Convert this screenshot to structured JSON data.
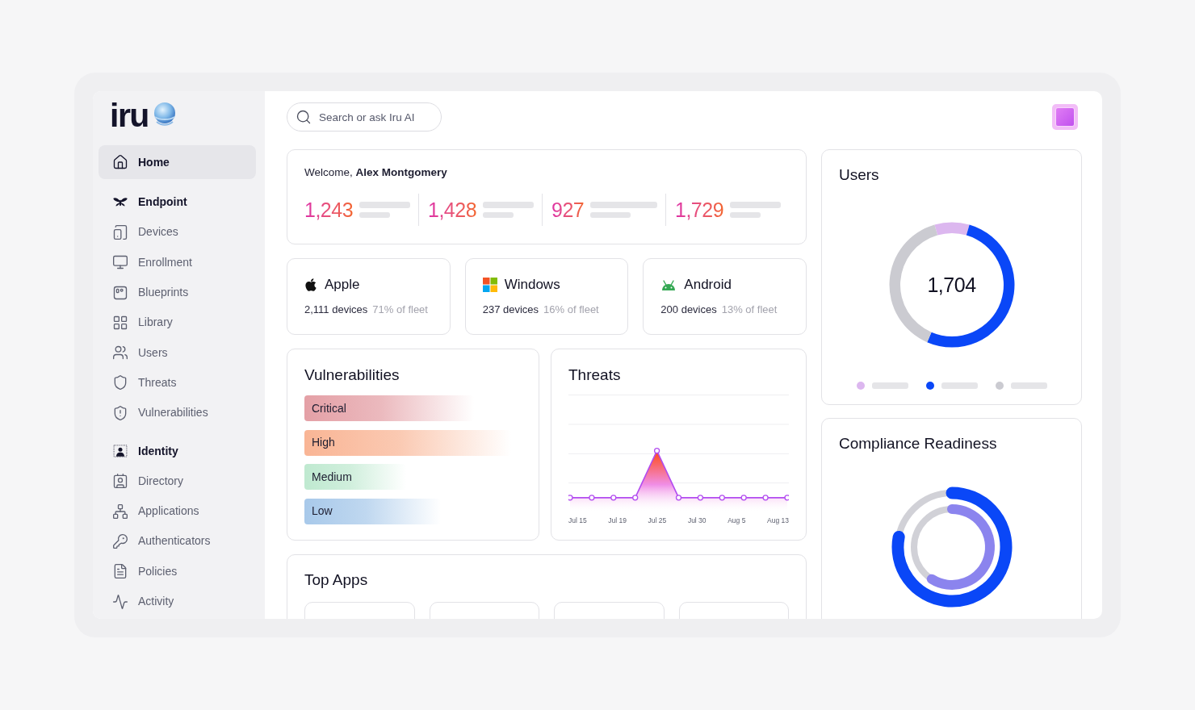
{
  "sidebar": {
    "logo": "iru",
    "nav": [
      {
        "kind": "item",
        "label": "Home",
        "selected": true
      },
      {
        "kind": "section",
        "label": "Endpoint",
        "selected": false
      },
      {
        "kind": "item",
        "label": "Devices",
        "selected": false
      },
      {
        "kind": "item",
        "label": "Enrollment",
        "selected": false
      },
      {
        "kind": "item",
        "label": "Blueprints",
        "selected": false
      },
      {
        "kind": "item",
        "label": "Library",
        "selected": false
      },
      {
        "kind": "item",
        "label": "Users",
        "selected": false
      },
      {
        "kind": "item",
        "label": "Threats",
        "selected": false
      },
      {
        "kind": "item",
        "label": "Vulnerabilities",
        "selected": false
      },
      {
        "kind": "section",
        "label": "Identity",
        "selected": false
      },
      {
        "kind": "item",
        "label": "Directory",
        "selected": false
      },
      {
        "kind": "item",
        "label": "Applications",
        "selected": false
      },
      {
        "kind": "item",
        "label": "Authenticators",
        "selected": false
      },
      {
        "kind": "item",
        "label": "Policies",
        "selected": false
      },
      {
        "kind": "item",
        "label": "Activity",
        "selected": false
      }
    ]
  },
  "search": {
    "placeholder": "Search or ask Iru AI"
  },
  "welcome": {
    "greeting": "Welcome, **Alex Montgomery**",
    "stats": [
      "1,243",
      "1,428",
      "927",
      "1,729"
    ]
  },
  "platforms": [
    {
      "kind": "apple",
      "name": "Apple",
      "devices": "2,111 devices",
      "share": "71% of fleet"
    },
    {
      "kind": "windows",
      "name": "Windows",
      "devices": "237 devices",
      "share": "16% of fleet"
    },
    {
      "kind": "android",
      "name": "Android",
      "devices": "200 devices",
      "share": "13% of fleet"
    }
  ],
  "vulnerabilities": {
    "title": "Vulnerabilities",
    "bars": [
      {
        "label": "Critical",
        "color": "#e4a0a6"
      },
      {
        "label": "High",
        "color": "#f9b595"
      },
      {
        "label": "Medium",
        "color": "#bfe9d0"
      },
      {
        "label": "Low",
        "color": "#a8c9ea"
      }
    ]
  },
  "threats": {
    "title": "Threats",
    "x_labels": [
      "Jul 15",
      "Jul 19",
      "Jul 25",
      "Jul 30",
      "Aug 5",
      "Aug 13"
    ]
  },
  "top_apps": {
    "title": "Top Apps"
  },
  "users": {
    "title": "Users",
    "total": "1,704",
    "legend": [
      {
        "color": "#dcb7ef"
      },
      {
        "color": "#0a47f7"
      },
      {
        "color": "#cbcbd1"
      }
    ],
    "chart_data": {
      "type": "donut",
      "values": [
        9,
        52,
        39
      ]
    }
  },
  "compliance": {
    "title": "Compliance Readiness"
  }
}
